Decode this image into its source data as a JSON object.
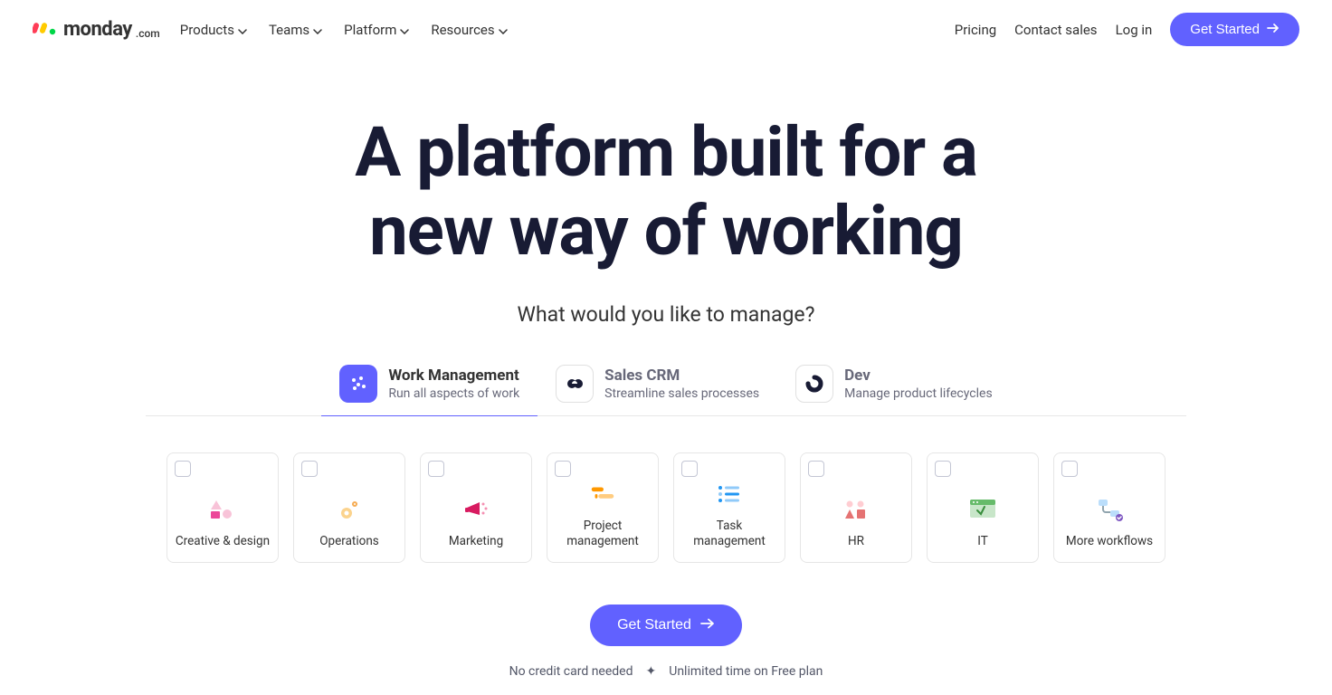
{
  "brand": {
    "name": "monday",
    "suffix": ".com"
  },
  "nav": {
    "items": [
      {
        "label": "Products"
      },
      {
        "label": "Teams"
      },
      {
        "label": "Platform"
      },
      {
        "label": "Resources"
      }
    ]
  },
  "header_right": {
    "pricing": "Pricing",
    "contact": "Contact sales",
    "login": "Log in",
    "cta": "Get Started"
  },
  "hero": {
    "title_line1": "A platform built for a",
    "title_line2": "new way of working",
    "subheading": "What would you like to manage?"
  },
  "tabs": [
    {
      "title": "Work Management",
      "subtitle": "Run all aspects of work",
      "icon": "work-management-icon",
      "active": true
    },
    {
      "title": "Sales CRM",
      "subtitle": "Streamline sales processes",
      "icon": "crm-icon",
      "active": false
    },
    {
      "title": "Dev",
      "subtitle": "Manage product lifecycles",
      "icon": "dev-icon",
      "active": false
    }
  ],
  "cards": [
    {
      "label": "Creative & design",
      "icon": "creative-design-icon"
    },
    {
      "label": "Operations",
      "icon": "operations-icon"
    },
    {
      "label": "Marketing",
      "icon": "marketing-icon"
    },
    {
      "label": "Project management",
      "icon": "project-management-icon"
    },
    {
      "label": "Task management",
      "icon": "task-management-icon"
    },
    {
      "label": "HR",
      "icon": "hr-icon"
    },
    {
      "label": "IT",
      "icon": "it-icon"
    },
    {
      "label": "More workflows",
      "icon": "more-workflows-icon"
    }
  ],
  "cta": {
    "button": "Get Started",
    "note_left": "No credit card needed",
    "note_right": "Unlimited time on Free plan"
  }
}
